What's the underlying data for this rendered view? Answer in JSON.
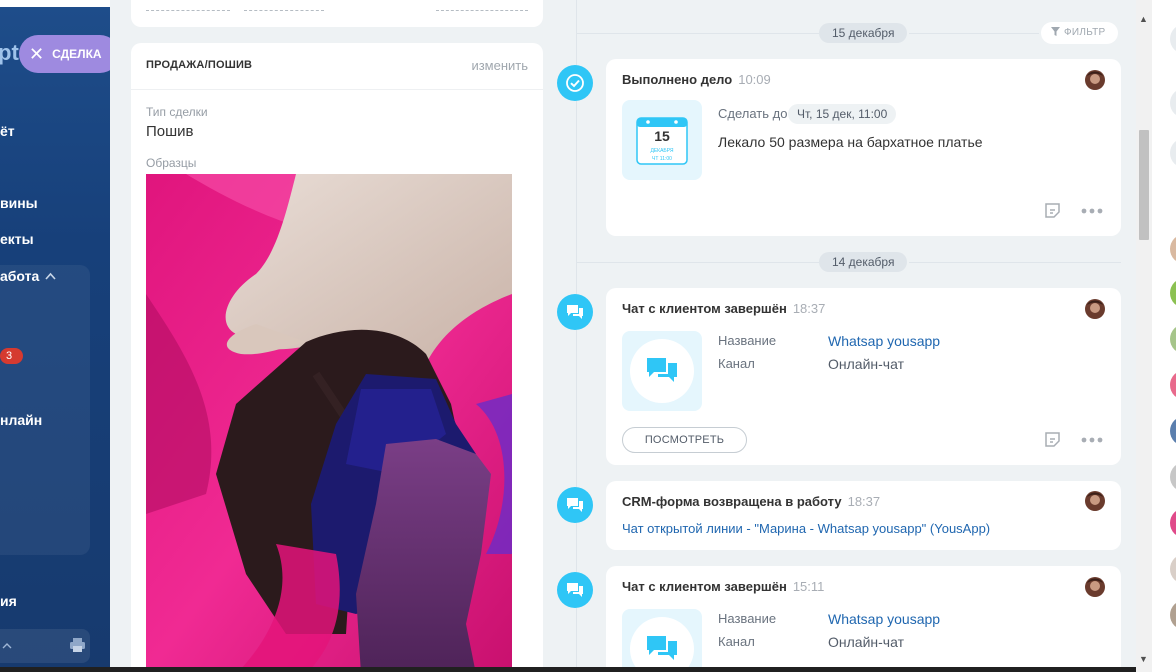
{
  "sidebar": {
    "logo_fragment": "pt",
    "deal_button": "СДЕЛКА",
    "items": [
      {
        "label": "ёт"
      },
      {
        "label": "вины"
      },
      {
        "label": "екты"
      },
      {
        "label": "абота"
      },
      {
        "label": "нлайн"
      },
      {
        "label": "ия"
      }
    ],
    "badge": "3"
  },
  "sale_card": {
    "title": "ПРОДАЖА/ПОШИВ",
    "change_link": "изменить",
    "deal_type_label": "Тип сделки",
    "deal_type_value": "Пошив",
    "samples_label": "Образцы"
  },
  "timeline": {
    "filter_label": "ФИЛЬТР",
    "dates": [
      "15 декабря",
      "14 декабря"
    ],
    "events": [
      {
        "title": "Выполнено дело",
        "time": "10:09",
        "due_label": "Сделать до",
        "due_value": "Чт, 15 дек, 11:00",
        "description": "Лекало 50 размера на бархатное платье",
        "calendar": {
          "day": "15",
          "month": "ДЕКАБРЯ",
          "time": "ЧТ 11:00"
        }
      },
      {
        "title": "Чат с клиентом завершён",
        "time": "18:37",
        "name_label": "Название",
        "name_value": "Whatsap yousapp",
        "channel_label": "Канал",
        "channel_value": "Онлайн-чат",
        "view_button": "ПОСМОТРЕТЬ"
      },
      {
        "title": "CRM-форма возвращена в работу",
        "time": "18:37",
        "link": "Чат открытой линии - \"Марина - Whatsap yousapp\" (YousApp)"
      },
      {
        "title": "Чат с клиентом завершён",
        "time": "15:11",
        "name_label": "Название",
        "name_value": "Whatsap yousapp",
        "channel_label": "Канал",
        "channel_value": "Онлайн-чат"
      }
    ]
  },
  "colors": {
    "accent": "#2fc6f6",
    "deal_button": "#9e8ae0",
    "link": "#2067b0",
    "sidebar": "#1e4d8a"
  },
  "icons": [
    "close-icon",
    "check-icon",
    "chat-icon",
    "calendar-icon",
    "note-icon",
    "more-icon",
    "filter-icon",
    "print-icon",
    "chevron-up-icon"
  ]
}
